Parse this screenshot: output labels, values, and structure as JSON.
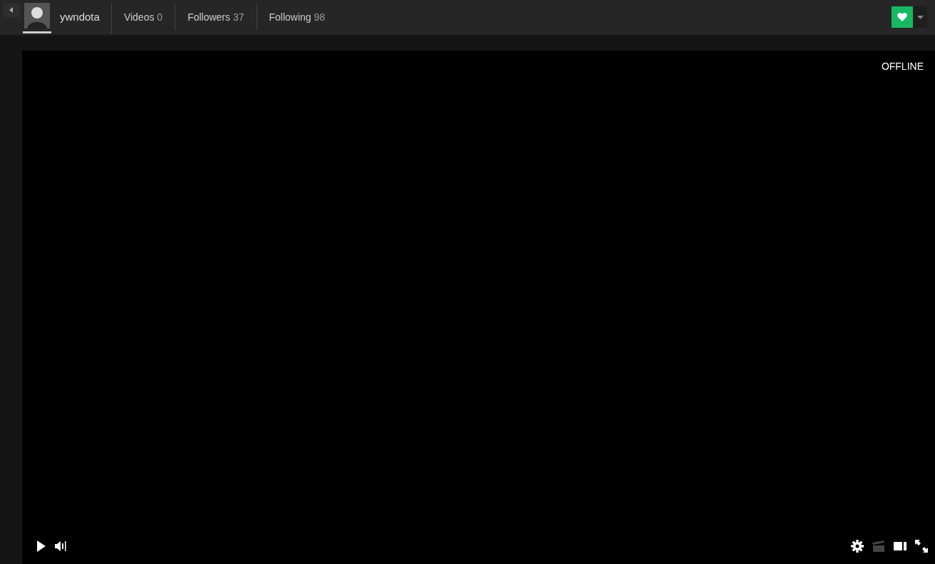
{
  "header": {
    "channel": {
      "name": "ywndota",
      "selected": true
    },
    "tabs": [
      {
        "label": "Videos",
        "count": "0",
        "selected": false
      },
      {
        "label": "Followers",
        "count": "37",
        "selected": false
      },
      {
        "label": "Following",
        "count": "98",
        "selected": false
      }
    ],
    "follow": {
      "on": true
    }
  },
  "player": {
    "status": "OFFLINE",
    "playing": false,
    "controls": {
      "clip_disabled": true
    }
  }
}
